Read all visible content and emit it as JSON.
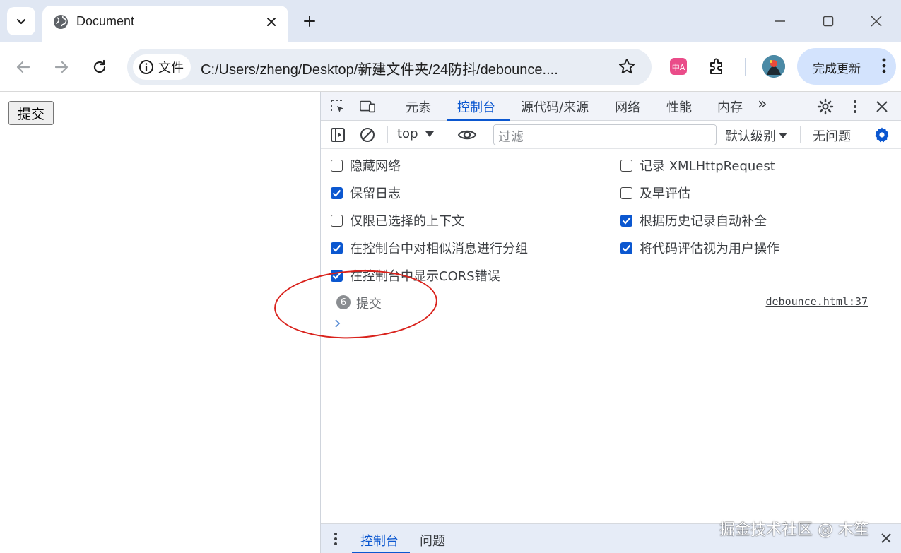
{
  "browser": {
    "tab_title": "Document",
    "site_chip_label": "文件",
    "url": "C:/Users/zheng/Desktop/新建文件夹/24防抖/debounce....",
    "update_button_label": "完成更新",
    "extension_icon_text": "中A"
  },
  "page": {
    "submit_button_label": "提交"
  },
  "devtools": {
    "tabs": [
      "元素",
      "控制台",
      "源代码/来源",
      "网络",
      "性能",
      "内存"
    ],
    "active_tab": "控制台",
    "more_tabs_glyph": "»",
    "console_bar": {
      "context": "top",
      "filter_placeholder": "过滤",
      "level": "默认级别",
      "issues": "无问题"
    },
    "settings": {
      "left": [
        {
          "label": "隐藏网络",
          "checked": false
        },
        {
          "label": "保留日志",
          "checked": true
        },
        {
          "label": "仅限已选择的上下文",
          "checked": false
        },
        {
          "label": "在控制台中对相似消息进行分组",
          "checked": true
        },
        {
          "label": "在控制台中显示CORS错误",
          "checked": true
        }
      ],
      "right": [
        {
          "label": "记录 XMLHttpRequest",
          "checked": false
        },
        {
          "label": "及早评估",
          "checked": false
        },
        {
          "label": "根据历史记录自动补全",
          "checked": true
        },
        {
          "label": "将代码评估视为用户操作",
          "checked": true
        }
      ]
    },
    "log": {
      "count": "6",
      "message": "提交",
      "source": "debounce.html:37"
    },
    "drawer": {
      "tabs": [
        "控制台",
        "问题"
      ],
      "active_tab": "控制台"
    }
  },
  "watermark": "掘金技术社区 @ 木笙",
  "colors": {
    "accent": "#0b57d0",
    "tabstrip_bg": "#e0e7f3",
    "annotation": "#d9221c"
  }
}
